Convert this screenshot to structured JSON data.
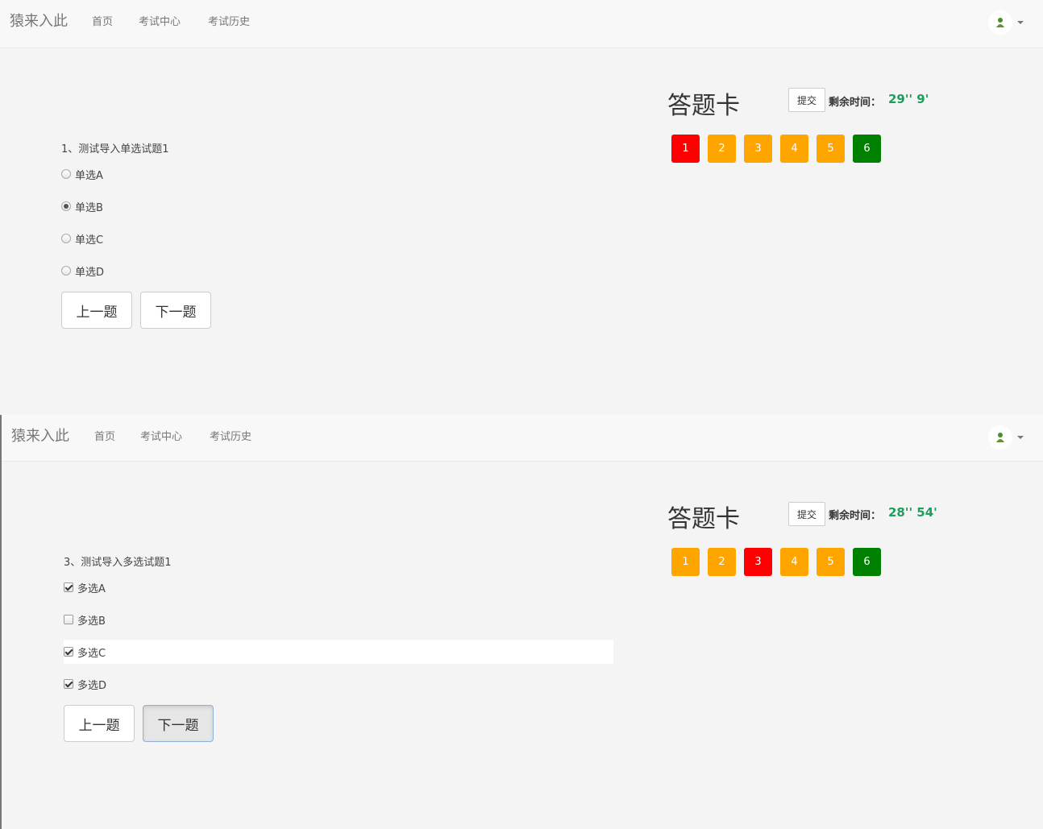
{
  "colors": {
    "answered": "#ffa500",
    "current": "#ff0000",
    "done": "#008000",
    "timer": "#1d9e5c"
  },
  "panels": [
    {
      "nav": {
        "brand": "猿来入此",
        "links": [
          "首页",
          "考试中心",
          "考试历史"
        ],
        "avatar_icon": "user-avatar-icon"
      },
      "question": "1、测试导入单选试题1",
      "type": "radio",
      "options": [
        {
          "label": "单选A",
          "checked": false
        },
        {
          "label": "单选B",
          "checked": true
        },
        {
          "label": "单选C",
          "checked": false
        },
        {
          "label": "单选D",
          "checked": false
        }
      ],
      "prev": "上一题",
      "next": "下一题",
      "card": {
        "title": "答题卡",
        "submit": "提交",
        "time_label": "剩余时间：",
        "time_value": "29'' 9'",
        "numbers": [
          {
            "n": "1",
            "status": "current"
          },
          {
            "n": "2",
            "status": "answered"
          },
          {
            "n": "3",
            "status": "answered"
          },
          {
            "n": "4",
            "status": "answered"
          },
          {
            "n": "5",
            "status": "answered"
          },
          {
            "n": "6",
            "status": "done"
          }
        ]
      }
    },
    {
      "nav": {
        "brand": "猿来入此",
        "links": [
          "首页",
          "考试中心",
          "考试历史"
        ],
        "avatar_icon": "user-avatar-icon"
      },
      "question": "3、测试导入多选试题1",
      "type": "checkbox",
      "options": [
        {
          "label": "多选A",
          "checked": true
        },
        {
          "label": "多选B",
          "checked": false
        },
        {
          "label": "多选C",
          "checked": true
        },
        {
          "label": "多选D",
          "checked": true
        }
      ],
      "prev": "上一题",
      "next": "下一题",
      "card": {
        "title": "答题卡",
        "submit": "提交",
        "time_label": "剩余时间：",
        "time_value": "28'' 54'",
        "numbers": [
          {
            "n": "1",
            "status": "answered"
          },
          {
            "n": "2",
            "status": "answered"
          },
          {
            "n": "3",
            "status": "current"
          },
          {
            "n": "4",
            "status": "answered"
          },
          {
            "n": "5",
            "status": "answered"
          },
          {
            "n": "6",
            "status": "done"
          }
        ]
      }
    }
  ]
}
